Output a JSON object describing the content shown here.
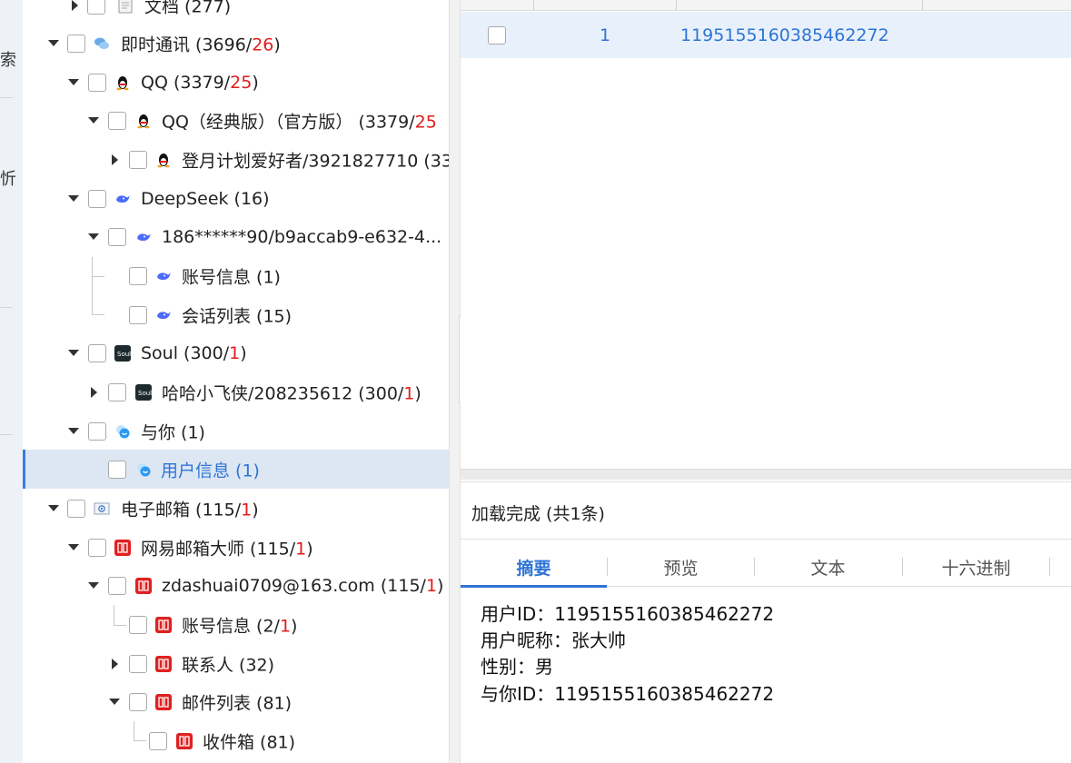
{
  "edge": {
    "glyph_top": "索",
    "glyph_mid": "忻"
  },
  "tree": {
    "rows": [
      {
        "label": "文档 (277)",
        "count_red": "",
        "suffix": ""
      },
      {
        "label": "即时通讯 (3696/",
        "count_red": "26",
        "suffix": ")"
      },
      {
        "label": "QQ (3379/",
        "count_red": "25",
        "suffix": ")"
      },
      {
        "label": "QQ（经典版）（官方版） (3379/",
        "count_red": "25",
        "suffix": ""
      },
      {
        "label": "登月计划爱好者/3921827710 (33",
        "count_red": "",
        "suffix": ""
      },
      {
        "label": "DeepSeek (16)",
        "count_red": "",
        "suffix": ""
      },
      {
        "label": "186******90/b9accab9-e632-4...",
        "count_red": "",
        "suffix": ""
      },
      {
        "label": "账号信息 (1)",
        "count_red": "",
        "suffix": ""
      },
      {
        "label": "会话列表 (15)",
        "count_red": "",
        "suffix": ""
      },
      {
        "label": "Soul (300/",
        "count_red": "1",
        "suffix": ")"
      },
      {
        "label": "哈哈小飞侠/208235612 (300/",
        "count_red": "1",
        "suffix": ")"
      },
      {
        "label": "与你 (1)",
        "count_red": "",
        "suffix": ""
      },
      {
        "label": "用户信息 (1)",
        "count_red": "",
        "suffix": ""
      },
      {
        "label": "电子邮箱 (115/",
        "count_red": "1",
        "suffix": ")"
      },
      {
        "label": "网易邮箱大师 (115/",
        "count_red": "1",
        "suffix": ")"
      },
      {
        "label": "zdashuai0709@163.com (115/",
        "count_red": "1",
        "suffix": ")"
      },
      {
        "label": "账号信息 (2/",
        "count_red": "1",
        "suffix": ")"
      },
      {
        "label": "联系人 (32)",
        "count_red": "",
        "suffix": ""
      },
      {
        "label": "邮件列表 (81)",
        "count_red": "",
        "suffix": ""
      },
      {
        "label": "收件箱 (81)",
        "count_red": "",
        "suffix": ""
      }
    ]
  },
  "grid": {
    "row_number": "1",
    "row_id": "1195155160385462272"
  },
  "status": {
    "text": "加载完成 (共1条)"
  },
  "tabs": [
    "摘要",
    "预览",
    "文本",
    "十六进制"
  ],
  "detail": {
    "lines": [
      "用户ID：1195155160385462272",
      "用户昵称：张大帅",
      "性别：男",
      "与你ID：1195155160385462272"
    ]
  },
  "colors": {
    "accent": "#2e74d6",
    "alert": "#e21b1b",
    "selection": "#dde7f3",
    "qq": "#111111",
    "mail": "#e02020",
    "deepseek": "#4d6bfe"
  }
}
